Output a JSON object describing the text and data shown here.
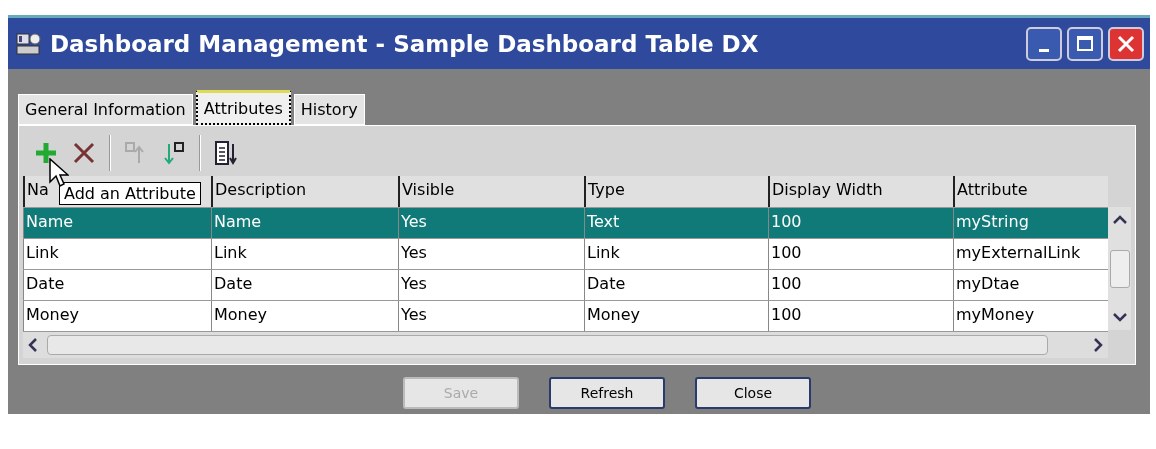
{
  "window": {
    "title": "Dashboard Management - Sample Dashboard Table DX"
  },
  "tabs": [
    {
      "label": "General Information",
      "selected": false
    },
    {
      "label": "Attributes",
      "selected": true
    },
    {
      "label": "History",
      "selected": false
    }
  ],
  "toolbar": [
    {
      "kind": "add",
      "disabled": false
    },
    {
      "kind": "delete",
      "disabled": false
    },
    {
      "kind": "move-up",
      "disabled": true
    },
    {
      "kind": "move-down",
      "disabled": false
    },
    {
      "kind": "sort",
      "disabled": false
    }
  ],
  "tooltip": "Add an Attribute",
  "table": {
    "columns": [
      "Na",
      "Description",
      "Visible",
      "Type",
      "Display Width",
      "Attribute"
    ],
    "rows": [
      {
        "cells": [
          "Name",
          "Name",
          "Yes",
          "Text",
          "100",
          "myString"
        ],
        "selected": true
      },
      {
        "cells": [
          "Link",
          "Link",
          "Yes",
          "Link",
          "100",
          "myExternalLink"
        ],
        "selected": false
      },
      {
        "cells": [
          "Date",
          "Date",
          "Yes",
          "Date",
          "100",
          "myDtae"
        ],
        "selected": false
      },
      {
        "cells": [
          "Money",
          "Money",
          "Yes",
          "Money",
          "100",
          "myMoney"
        ],
        "selected": false
      }
    ]
  },
  "buttons": [
    {
      "label": "Save",
      "disabled": true
    },
    {
      "label": "Refresh",
      "disabled": false
    },
    {
      "label": "Close",
      "disabled": false
    }
  ]
}
